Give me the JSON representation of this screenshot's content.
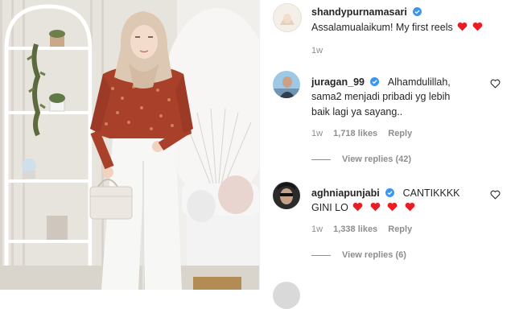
{
  "post": {
    "author": "shandypurnamasari",
    "caption": "Assalamualaikum! My first reels",
    "caption_emojis": [
      "red-heart",
      "red-heart"
    ],
    "time": "1w"
  },
  "comments": [
    {
      "username": "juragan_99",
      "verified": true,
      "text_line1": "Alhamdulillah,",
      "text_line2": "sama2 menjadi pribadi yg lebih",
      "text_line3": "baik lagi ya sayang..",
      "time": "1w",
      "likes": "1,718 likes",
      "reply": "Reply",
      "view_replies": "View replies (42)"
    },
    {
      "username": "aghniapunjabi",
      "verified": true,
      "text_line1": "CANTIKKKK",
      "text_line2": "GINI LO",
      "text_emojis": [
        "red-heart",
        "red-heart",
        "red-heart",
        "red-heart"
      ],
      "time": "1w",
      "likes": "1,338 likes",
      "reply": "Reply",
      "view_replies": "View replies (6)"
    }
  ],
  "colors": {
    "text": "#262626",
    "muted": "#8e8e8e",
    "verified_blue": "#3897f0",
    "heart_red": "#ed1c24"
  },
  "icons": [
    "verified-icon",
    "heart-outline-icon",
    "red-heart-emoji"
  ]
}
